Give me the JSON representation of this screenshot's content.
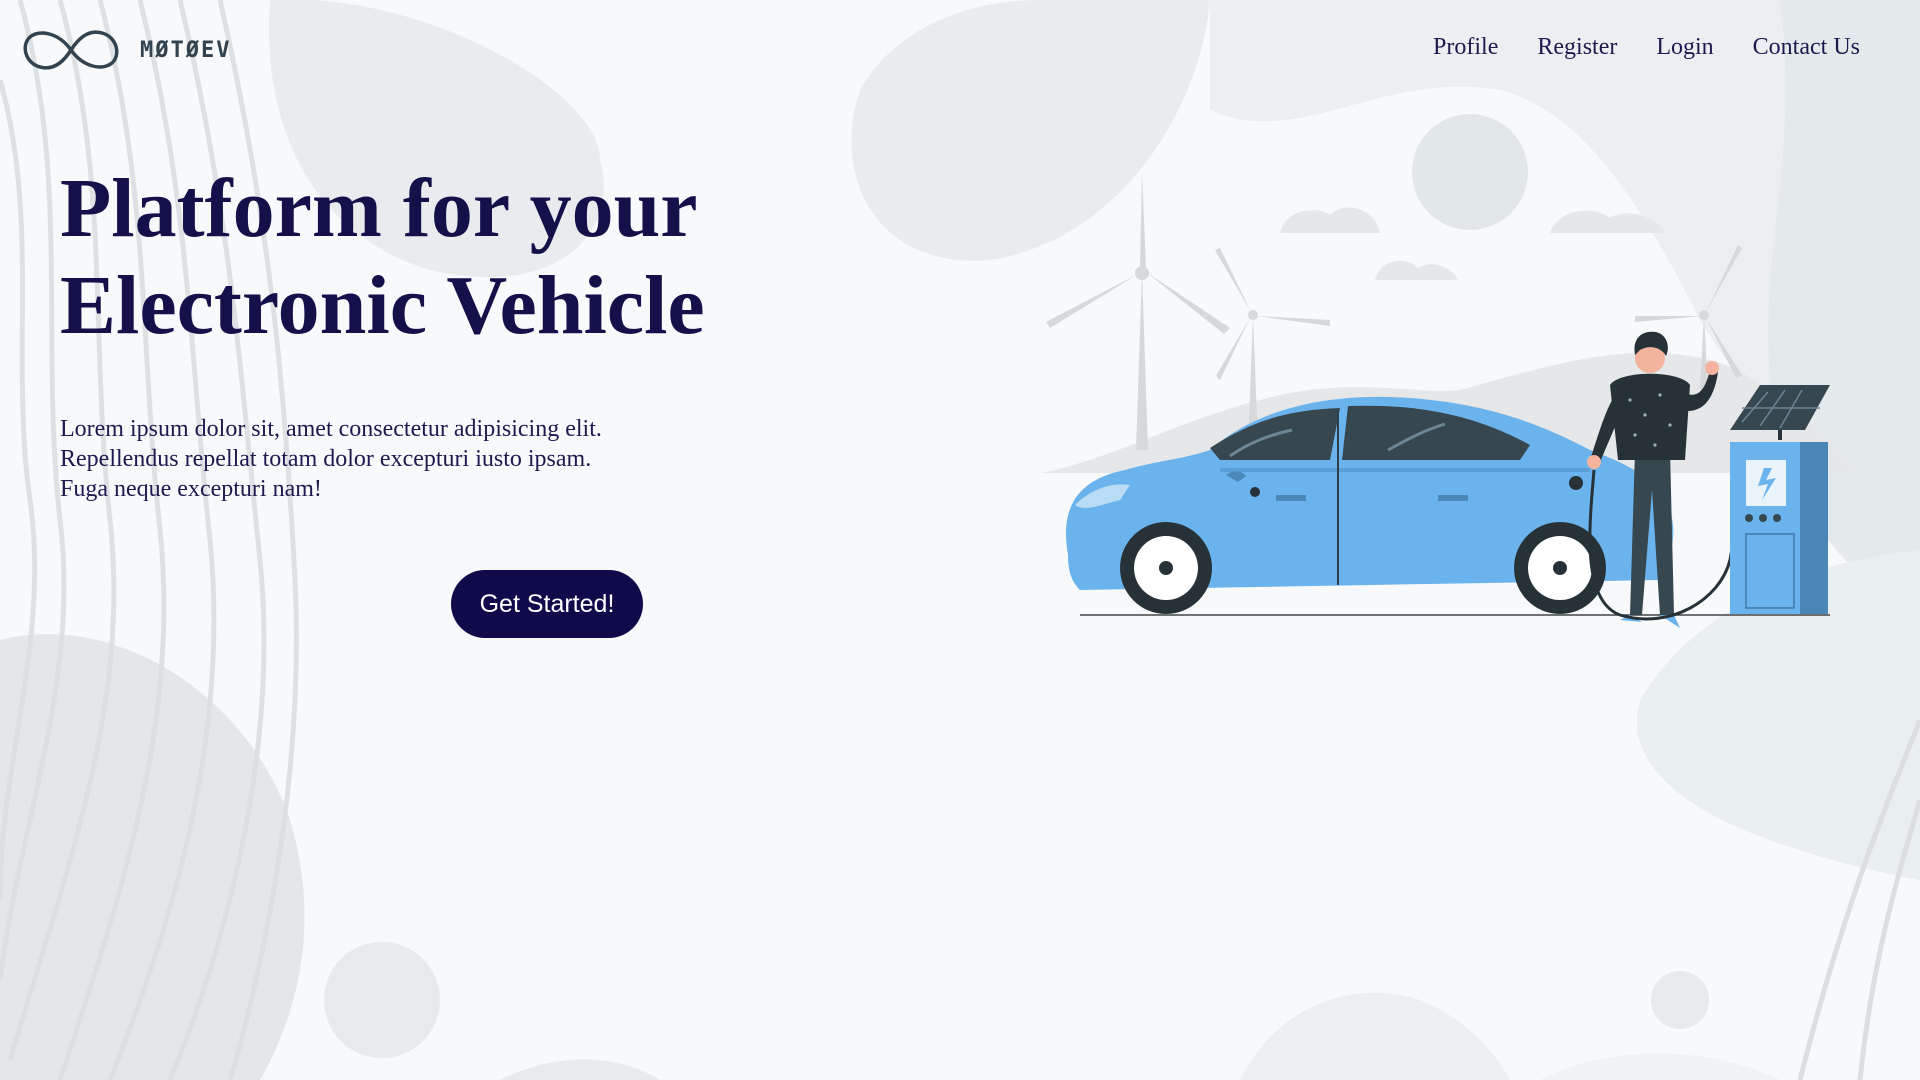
{
  "brand": {
    "name": "MØTØEV",
    "logo_icon": "infinity-logo-icon"
  },
  "nav": {
    "items": [
      {
        "label": "Profile"
      },
      {
        "label": "Register"
      },
      {
        "label": "Login"
      },
      {
        "label": "Contact Us"
      }
    ]
  },
  "hero": {
    "title_line1": "Platform for your",
    "title_line2": "Electronic Vehicle",
    "desc_line1": "Lorem ipsum dolor sit, amet consectetur adipisicing elit.",
    "desc_line2": "Repellendus repellat totam dolor excepturi iusto ipsam.",
    "desc_line3": "Fuga neque excepturi nam!",
    "cta_label": "Get Started!"
  },
  "illustration": {
    "subject": "person-charging-electric-car",
    "icons": [
      "wind-turbine-icon",
      "electric-car-icon",
      "charging-station-icon",
      "solar-panel-icon",
      "lightning-bolt-icon"
    ]
  },
  "colors": {
    "title": "#13104a",
    "text": "#1d1a4f",
    "button": "#0f0a4a",
    "car": "#6bb3ec",
    "background": "#f6f8f9"
  }
}
